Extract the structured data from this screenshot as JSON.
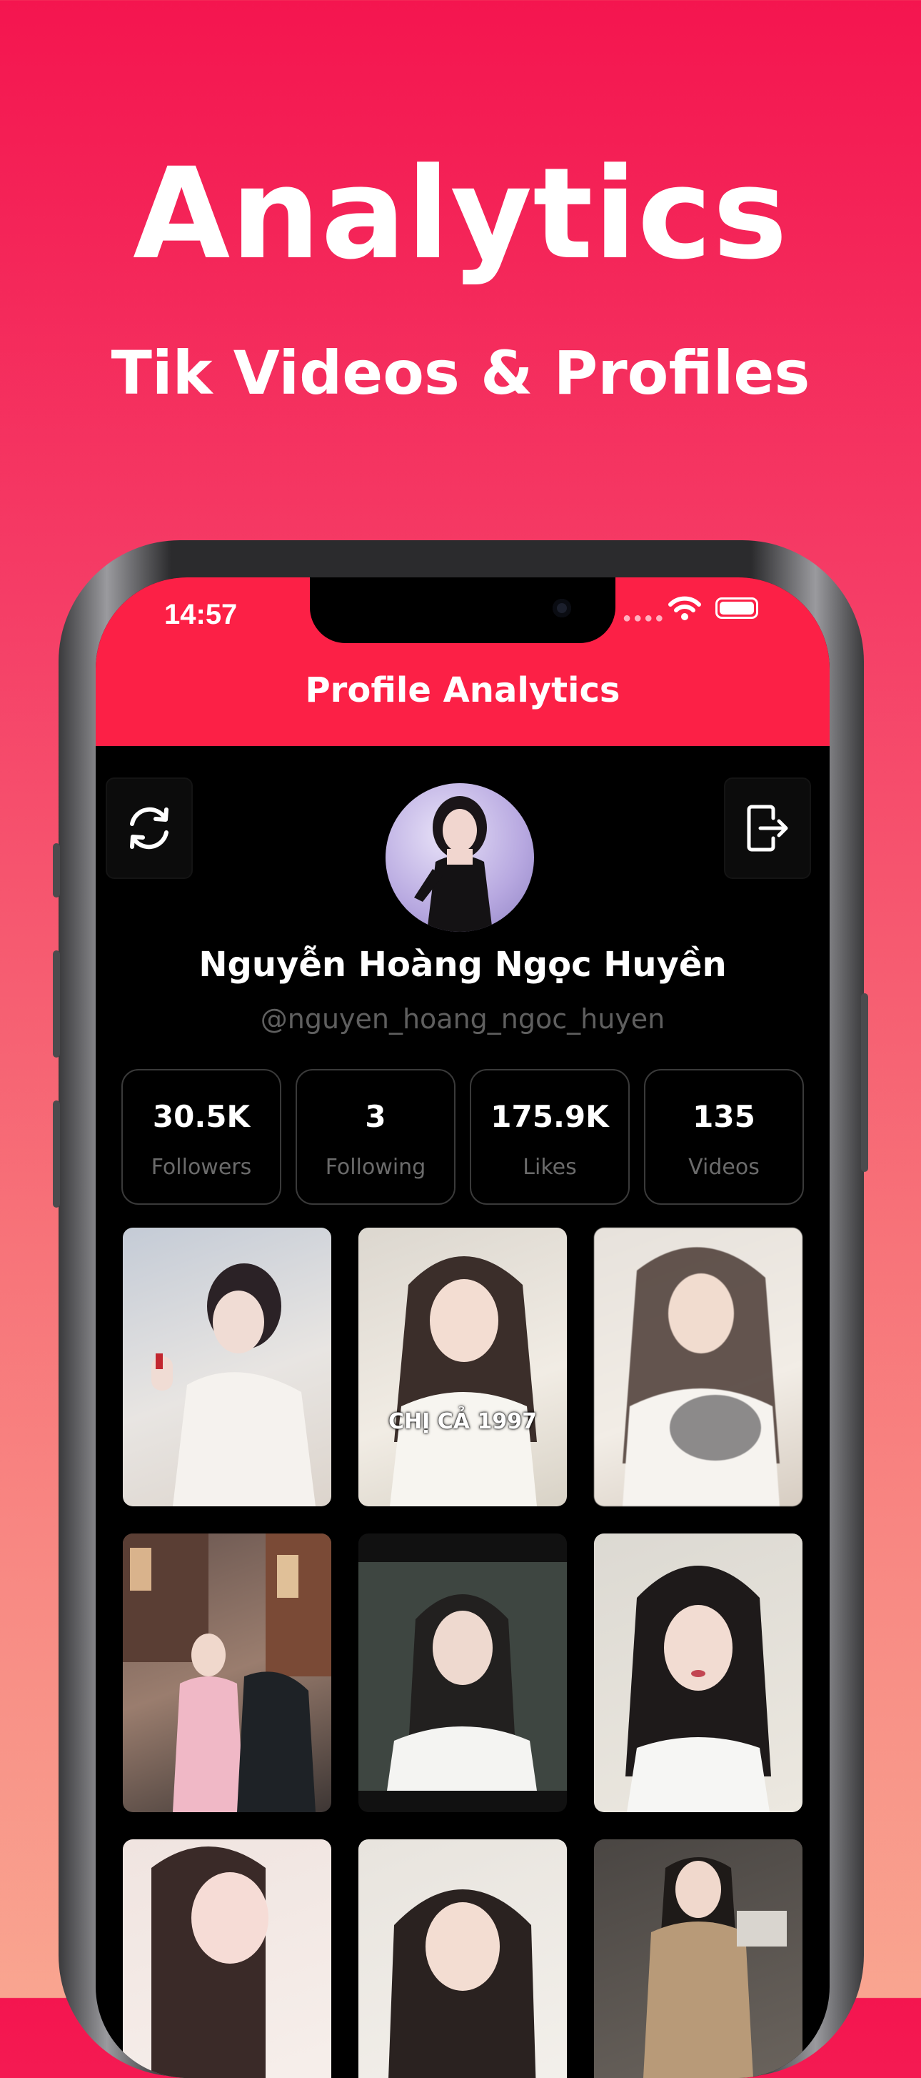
{
  "headline": {
    "title": "Analytics",
    "subtitle": "Tik Videos & Profiles"
  },
  "status_bar": {
    "time": "14:57"
  },
  "app": {
    "title": "Profile Analytics",
    "accent_color": "#fc2046"
  },
  "toolbar": {
    "refresh_icon": "refresh-icon",
    "logout_icon": "logout-icon"
  },
  "profile": {
    "name": "Nguyễn Hoàng Ngọc Huyền",
    "handle": "@nguyen_hoang_ngoc_huyen"
  },
  "stats": [
    {
      "value": "30.5K",
      "label": "Followers"
    },
    {
      "value": "3",
      "label": "Following"
    },
    {
      "value": "175.9K",
      "label": "Likes"
    },
    {
      "value": "135",
      "label": "Videos"
    }
  ],
  "videos": [
    {
      "caption": ""
    },
    {
      "caption": "CHỊ CẢ 1997"
    },
    {
      "caption": ""
    },
    {
      "caption": ""
    },
    {
      "caption": ""
    },
    {
      "caption": ""
    },
    {
      "caption": ""
    },
    {
      "caption": ""
    },
    {
      "caption": ""
    }
  ]
}
